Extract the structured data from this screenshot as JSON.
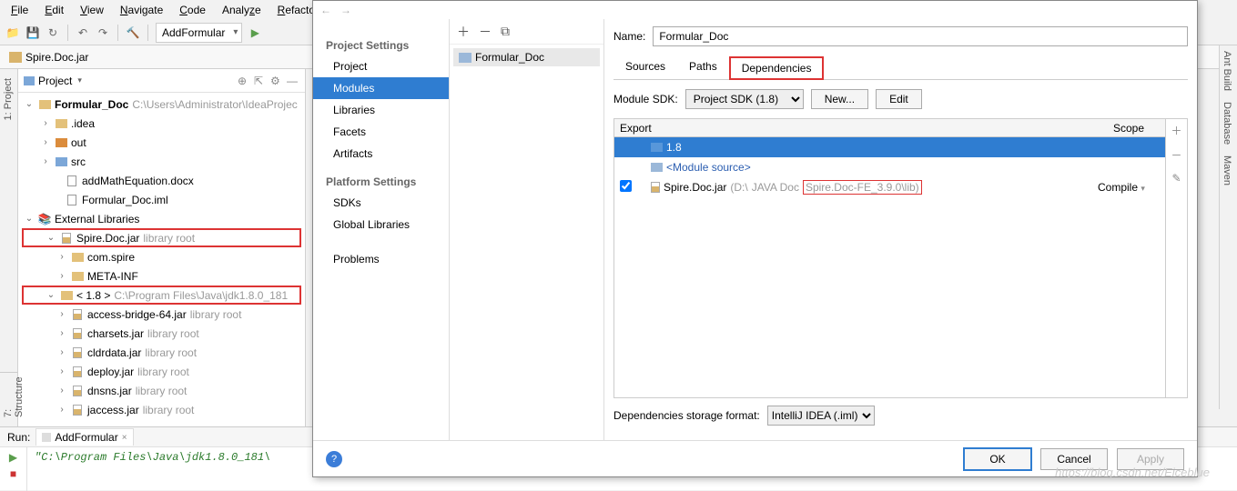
{
  "menu": [
    "File",
    "Edit",
    "View",
    "Navigate",
    "Code",
    "Analyze",
    "Refactor"
  ],
  "toolbar": {
    "config": "AddFormular"
  },
  "breadcrumb": "Spire.Doc.jar",
  "projectPanel": {
    "title": "Project"
  },
  "tree": {
    "root": "Formular_Doc",
    "rootPath": "C:\\Users\\Administrator\\IdeaProjec",
    "idea": ".idea",
    "out": "out",
    "src": "src",
    "docx": "addMathEquation.docx",
    "iml": "Formular_Doc.iml",
    "extlib": "External Libraries",
    "spirejar": "Spire.Doc.jar",
    "spirejarNote": "library root",
    "comspire": "com.spire",
    "metainf": "META-INF",
    "jdk": "< 1.8 >",
    "jdkPath": "C:\\Program Files\\Java\\jdk1.8.0_181",
    "jars": [
      "access-bridge-64.jar",
      "charsets.jar",
      "cldrdata.jar",
      "deploy.jar",
      "dnsns.jar",
      "jaccess.jar"
    ],
    "libroot": "library root"
  },
  "dialog": {
    "sections1": "Project Settings",
    "items1": [
      "Project",
      "Modules",
      "Libraries",
      "Facets",
      "Artifacts"
    ],
    "sections2": "Platform Settings",
    "items2": [
      "SDKs",
      "Global Libraries"
    ],
    "problems": "Problems",
    "module": "Formular_Doc",
    "nameLabel": "Name:",
    "nameValue": "Formular_Doc",
    "tabs": [
      "Sources",
      "Paths",
      "Dependencies"
    ],
    "sdkLabel": "Module SDK:",
    "sdkValue": "Project SDK (1.8)",
    "newBtn": "New...",
    "editBtn": "Edit",
    "colExport": "Export",
    "colScope": "Scope",
    "dep1": "1.8",
    "dep2": "<Module source>",
    "dep3": "Spire.Doc.jar",
    "dep3path1": "(D:\\",
    "dep3path2": "JAVA Doc",
    "dep3path3": "Spire.Doc-FE_3.9.0\\lib)",
    "scopeCompile": "Compile",
    "storageLabel": "Dependencies storage format:",
    "storageValue": "IntelliJ IDEA (.iml)",
    "ok": "OK",
    "cancel": "Cancel",
    "apply": "Apply"
  },
  "run": {
    "label": "Run:",
    "tab": "AddFormular",
    "output": "\"C:\\Program Files\\Java\\jdk1.8.0_181\\"
  },
  "sideRight": [
    "Ant Build",
    "Database",
    "Maven"
  ],
  "watermark": "https://blog.csdn.net/Eiceblue"
}
